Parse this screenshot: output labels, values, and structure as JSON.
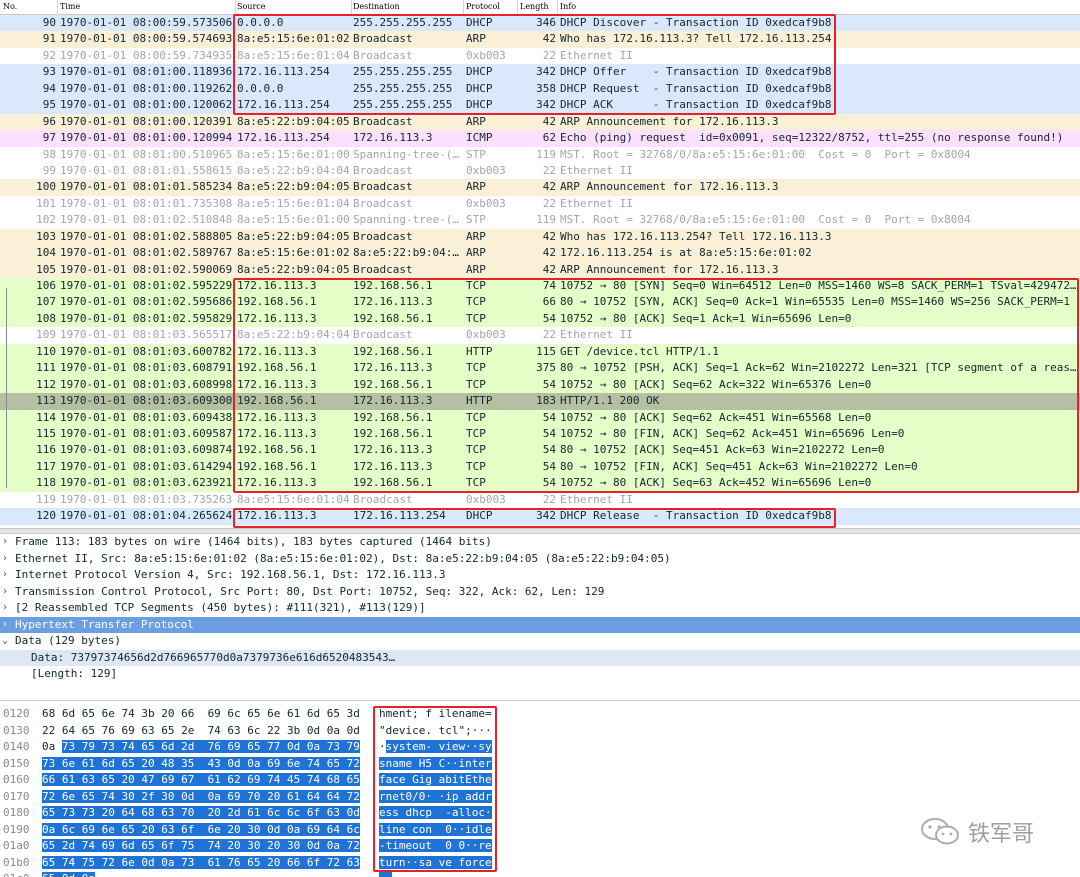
{
  "columns": [
    "No.",
    "Time",
    "Source",
    "Destination",
    "Protocol",
    "Length",
    "Info"
  ],
  "packets": [
    {
      "no": "90",
      "time": "1970-01-01 08:00:59.573506",
      "src": "0.0.0.0",
      "dst": "255.255.255.255",
      "proto": "DHCP",
      "len": "346",
      "info": "DHCP Discover - Transaction ID 0xedcaf9b8",
      "cls": "p-dhcp"
    },
    {
      "no": "91",
      "time": "1970-01-01 08:00:59.574693",
      "src": "8a:e5:15:6e:01:02",
      "dst": "Broadcast",
      "proto": "ARP",
      "len": "42",
      "info": "Who has 172.16.113.3? Tell 172.16.113.254",
      "cls": "p-arp"
    },
    {
      "no": "92",
      "time": "1970-01-01 08:00:59.734935",
      "src": "8a:e5:15:6e:01:04",
      "dst": "Broadcast",
      "proto": "0xb003",
      "len": "22",
      "info": "Ethernet II",
      "cls": "p-eth"
    },
    {
      "no": "93",
      "time": "1970-01-01 08:01:00.118936",
      "src": "172.16.113.254",
      "dst": "255.255.255.255",
      "proto": "DHCP",
      "len": "342",
      "info": "DHCP Offer    - Transaction ID 0xedcaf9b8",
      "cls": "p-dhcp"
    },
    {
      "no": "94",
      "time": "1970-01-01 08:01:00.119262",
      "src": "0.0.0.0",
      "dst": "255.255.255.255",
      "proto": "DHCP",
      "len": "358",
      "info": "DHCP Request  - Transaction ID 0xedcaf9b8",
      "cls": "p-dhcp"
    },
    {
      "no": "95",
      "time": "1970-01-01 08:01:00.120062",
      "src": "172.16.113.254",
      "dst": "255.255.255.255",
      "proto": "DHCP",
      "len": "342",
      "info": "DHCP ACK      - Transaction ID 0xedcaf9b8",
      "cls": "p-dhcp"
    },
    {
      "no": "96",
      "time": "1970-01-01 08:01:00.120391",
      "src": "8a:e5:22:b9:04:05",
      "dst": "Broadcast",
      "proto": "ARP",
      "len": "42",
      "info": "ARP Announcement for 172.16.113.3",
      "cls": "p-arp"
    },
    {
      "no": "97",
      "time": "1970-01-01 08:01:00.120994",
      "src": "172.16.113.254",
      "dst": "172.16.113.3",
      "proto": "ICMP",
      "len": "62",
      "info": "Echo (ping) request  id=0x0091, seq=12322/8752, ttl=255 (no response found!)",
      "cls": "p-icmp"
    },
    {
      "no": "98",
      "time": "1970-01-01 08:01:00.510965",
      "src": "8a:e5:15:6e:01:00",
      "dst": "Spanning-tree-(…",
      "proto": "STP",
      "len": "119",
      "info": "MST. Root = 32768/0/8a:e5:15:6e:01:00  Cost = 0  Port = 0x8004",
      "cls": "p-stp"
    },
    {
      "no": "99",
      "time": "1970-01-01 08:01:01.558615",
      "src": "8a:e5:22:b9:04:04",
      "dst": "Broadcast",
      "proto": "0xb003",
      "len": "22",
      "info": "Ethernet II",
      "cls": "p-eth"
    },
    {
      "no": "100",
      "time": "1970-01-01 08:01:01.585234",
      "src": "8a:e5:22:b9:04:05",
      "dst": "Broadcast",
      "proto": "ARP",
      "len": "42",
      "info": "ARP Announcement for 172.16.113.3",
      "cls": "p-arp"
    },
    {
      "no": "101",
      "time": "1970-01-01 08:01:01.735308",
      "src": "8a:e5:15:6e:01:04",
      "dst": "Broadcast",
      "proto": "0xb003",
      "len": "22",
      "info": "Ethernet II",
      "cls": "p-eth"
    },
    {
      "no": "102",
      "time": "1970-01-01 08:01:02.510848",
      "src": "8a:e5:15:6e:01:00",
      "dst": "Spanning-tree-(…",
      "proto": "STP",
      "len": "119",
      "info": "MST. Root = 32768/0/8a:e5:15:6e:01:00  Cost = 0  Port = 0x8004",
      "cls": "p-stp"
    },
    {
      "no": "103",
      "time": "1970-01-01 08:01:02.588805",
      "src": "8a:e5:22:b9:04:05",
      "dst": "Broadcast",
      "proto": "ARP",
      "len": "42",
      "info": "Who has 172.16.113.254? Tell 172.16.113.3",
      "cls": "p-arp"
    },
    {
      "no": "104",
      "time": "1970-01-01 08:01:02.589767",
      "src": "8a:e5:15:6e:01:02",
      "dst": "8a:e5:22:b9:04:…",
      "proto": "ARP",
      "len": "42",
      "info": "172.16.113.254 is at 8a:e5:15:6e:01:02",
      "cls": "p-arp"
    },
    {
      "no": "105",
      "time": "1970-01-01 08:01:02.590069",
      "src": "8a:e5:22:b9:04:05",
      "dst": "Broadcast",
      "proto": "ARP",
      "len": "42",
      "info": "ARP Announcement for 172.16.113.3",
      "cls": "p-arp"
    },
    {
      "no": "106",
      "time": "1970-01-01 08:01:02.595229",
      "src": "172.16.113.3",
      "dst": "192.168.56.1",
      "proto": "TCP",
      "len": "74",
      "info": "10752 → 80 [SYN] Seq=0 Win=64512 Len=0 MSS=1460 WS=8 SACK_PERM=1 TSval=429472…",
      "cls": "p-tcp"
    },
    {
      "no": "107",
      "time": "1970-01-01 08:01:02.595686",
      "src": "192.168.56.1",
      "dst": "172.16.113.3",
      "proto": "TCP",
      "len": "66",
      "info": "80 → 10752 [SYN, ACK] Seq=0 Ack=1 Win=65535 Len=0 MSS=1460 WS=256 SACK_PERM=1",
      "cls": "p-tcp"
    },
    {
      "no": "108",
      "time": "1970-01-01 08:01:02.595829",
      "src": "172.16.113.3",
      "dst": "192.168.56.1",
      "proto": "TCP",
      "len": "54",
      "info": "10752 → 80 [ACK] Seq=1 Ack=1 Win=65696 Len=0",
      "cls": "p-tcp"
    },
    {
      "no": "109",
      "time": "1970-01-01 08:01:03.565517",
      "src": "8a:e5:22:b9:04:04",
      "dst": "Broadcast",
      "proto": "0xb003",
      "len": "22",
      "info": "Ethernet II",
      "cls": "p-eth"
    },
    {
      "no": "110",
      "time": "1970-01-01 08:01:03.600782",
      "src": "172.16.113.3",
      "dst": "192.168.56.1",
      "proto": "HTTP",
      "len": "115",
      "info": "GET /device.tcl HTTP/1.1",
      "cls": "p-http"
    },
    {
      "no": "111",
      "time": "1970-01-01 08:01:03.608791",
      "src": "192.168.56.1",
      "dst": "172.16.113.3",
      "proto": "TCP",
      "len": "375",
      "info": "80 → 10752 [PSH, ACK] Seq=1 Ack=62 Win=2102272 Len=321 [TCP segment of a reas…",
      "cls": "p-tcp"
    },
    {
      "no": "112",
      "time": "1970-01-01 08:01:03.608998",
      "src": "172.16.113.3",
      "dst": "192.168.56.1",
      "proto": "TCP",
      "len": "54",
      "info": "10752 → 80 [ACK] Seq=62 Ack=322 Win=65376 Len=0",
      "cls": "p-tcp"
    },
    {
      "no": "113",
      "time": "1970-01-01 08:01:03.609300",
      "src": "192.168.56.1",
      "dst": "172.16.113.3",
      "proto": "HTTP",
      "len": "183",
      "info": "HTTP/1.1 200 OK",
      "cls": "p-sel"
    },
    {
      "no": "114",
      "time": "1970-01-01 08:01:03.609438",
      "src": "172.16.113.3",
      "dst": "192.168.56.1",
      "proto": "TCP",
      "len": "54",
      "info": "10752 → 80 [ACK] Seq=62 Ack=451 Win=65568 Len=0",
      "cls": "p-tcp"
    },
    {
      "no": "115",
      "time": "1970-01-01 08:01:03.609587",
      "src": "172.16.113.3",
      "dst": "192.168.56.1",
      "proto": "TCP",
      "len": "54",
      "info": "10752 → 80 [FIN, ACK] Seq=62 Ack=451 Win=65696 Len=0",
      "cls": "p-tcp"
    },
    {
      "no": "116",
      "time": "1970-01-01 08:01:03.609874",
      "src": "192.168.56.1",
      "dst": "172.16.113.3",
      "proto": "TCP",
      "len": "54",
      "info": "80 → 10752 [ACK] Seq=451 Ack=63 Win=2102272 Len=0",
      "cls": "p-tcp"
    },
    {
      "no": "117",
      "time": "1970-01-01 08:01:03.614294",
      "src": "192.168.56.1",
      "dst": "172.16.113.3",
      "proto": "TCP",
      "len": "54",
      "info": "80 → 10752 [FIN, ACK] Seq=451 Ack=63 Win=2102272 Len=0",
      "cls": "p-tcp"
    },
    {
      "no": "118",
      "time": "1970-01-01 08:01:03.623921",
      "src": "172.16.113.3",
      "dst": "192.168.56.1",
      "proto": "TCP",
      "len": "54",
      "info": "10752 → 80 [ACK] Seq=63 Ack=452 Win=65696 Len=0",
      "cls": "p-tcp"
    },
    {
      "no": "119",
      "time": "1970-01-01 08:01:03.735263",
      "src": "8a:e5:15:6e:01:04",
      "dst": "Broadcast",
      "proto": "0xb003",
      "len": "22",
      "info": "Ethernet II",
      "cls": "p-eth"
    },
    {
      "no": "120",
      "time": "1970-01-01 08:01:04.265624",
      "src": "172.16.113.3",
      "dst": "172.16.113.254",
      "proto": "DHCP",
      "len": "342",
      "info": "DHCP Release  - Transaction ID 0xedcaf9b8",
      "cls": "p-dhcp"
    }
  ],
  "details": [
    {
      "arrow": ">",
      "text": "Frame 113: 183 bytes on wire (1464 bits), 183 bytes captured (1464 bits)",
      "cls": ""
    },
    {
      "arrow": ">",
      "text": "Ethernet II, Src: 8a:e5:15:6e:01:02 (8a:e5:15:6e:01:02), Dst: 8a:e5:22:b9:04:05 (8a:e5:22:b9:04:05)",
      "cls": ""
    },
    {
      "arrow": ">",
      "text": "Internet Protocol Version 4, Src: 192.168.56.1, Dst: 172.16.113.3",
      "cls": ""
    },
    {
      "arrow": ">",
      "text": "Transmission Control Protocol, Src Port: 80, Dst Port: 10752, Seq: 322, Ack: 62, Len: 129",
      "cls": ""
    },
    {
      "arrow": ">",
      "text": "[2 Reassembled TCP Segments (450 bytes): #111(321), #113(129)]",
      "cls": ""
    },
    {
      "arrow": ">",
      "text": "Hypertext Transfer Protocol",
      "cls": "sel"
    },
    {
      "arrow": "v",
      "text": "Data (129 bytes)",
      "cls": ""
    },
    {
      "arrow": "",
      "text": "Data: 73797374656d2d766965770d0a7379736e616d6520483543…",
      "cls": "sub hl"
    },
    {
      "arrow": "",
      "text": "[Length: 129]",
      "cls": "sub"
    }
  ],
  "bytes": [
    {
      "off": "0120",
      "hex": [
        [
          "68 6d 65 6e 74 3b 20 66  69 6c 65 6e 61 6d 65 3d",
          ""
        ]
      ],
      "asc": [
        [
          "hment; f ilename=",
          ""
        ]
      ]
    },
    {
      "off": "0130",
      "hex": [
        [
          "22 64 65 76 69 63 65 2e  74 63 6c 22 3b 0d 0a 0d",
          ""
        ]
      ],
      "asc": [
        [
          "\"device. tcl\";···",
          ""
        ]
      ]
    },
    {
      "off": "0140",
      "hex": [
        [
          "0a ",
          ""
        ],
        [
          "73 79 73 74 65 6d 2d  76 69 65 77 0d 0a 73 79",
          "sel"
        ]
      ],
      "asc": [
        [
          "·",
          ""
        ],
        [
          "system- view··sy",
          "sel"
        ]
      ]
    },
    {
      "off": "0150",
      "hex": [
        [
          "73 6e 61 6d 65 20 48 35  43 0d 0a 69 6e 74 65 72",
          "sel"
        ]
      ],
      "asc": [
        [
          "sname H5 C··inter",
          "sel"
        ]
      ]
    },
    {
      "off": "0160",
      "hex": [
        [
          "66 61 63 65 20 47 69 67  61 62 69 74 45 74 68 65",
          "sel"
        ]
      ],
      "asc": [
        [
          "face Gig abitEthe",
          "sel"
        ]
      ]
    },
    {
      "off": "0170",
      "hex": [
        [
          "72 6e 65 74 30 2f 30 0d  0a 69 70 20 61 64 64 72",
          "sel"
        ]
      ],
      "asc": [
        [
          "rnet0/0· ·ip addr",
          "sel"
        ]
      ]
    },
    {
      "off": "0180",
      "hex": [
        [
          "65 73 73 20 64 68 63 70  20 2d 61 6c 6c 6f 63 0d",
          "sel"
        ]
      ],
      "asc": [
        [
          "ess dhcp  -alloc·",
          "sel"
        ]
      ]
    },
    {
      "off": "0190",
      "hex": [
        [
          "0a 6c 69 6e 65 20 63 6f  6e 20 30 0d 0a 69 64 6c",
          "sel"
        ]
      ],
      "asc": [
        [
          "line con  0··idle",
          "sel"
        ]
      ]
    },
    {
      "off": "01a0",
      "hex": [
        [
          "65 2d 74 69 6d 65 6f 75  74 20 30 20 30 0d 0a 72",
          "sel"
        ]
      ],
      "asc": [
        [
          "-timeout  0 0··re",
          "sel"
        ]
      ]
    },
    {
      "off": "01b0",
      "hex": [
        [
          "65 74 75 72 6e 0d 0a 73  61 76 65 20 66 6f 72 63",
          "sel"
        ]
      ],
      "asc": [
        [
          "turn··sa ve force",
          "sel"
        ]
      ]
    },
    {
      "off": "01c0",
      "hex": [
        [
          "65 0d 0a",
          "sel"
        ]
      ],
      "asc": [
        [
          "··",
          "sel"
        ]
      ]
    }
  ],
  "watermark": {
    "text": "铁军哥",
    "icon": "wechat-logo-icon"
  },
  "colors": {
    "highlight_box": "#e8202a",
    "selection": "#1f73d6",
    "dhcp_row": "#dae8fc",
    "arp_row": "#faf0d7",
    "tcp_row": "#e4ffc7",
    "icmp_row": "#fce0ff"
  }
}
